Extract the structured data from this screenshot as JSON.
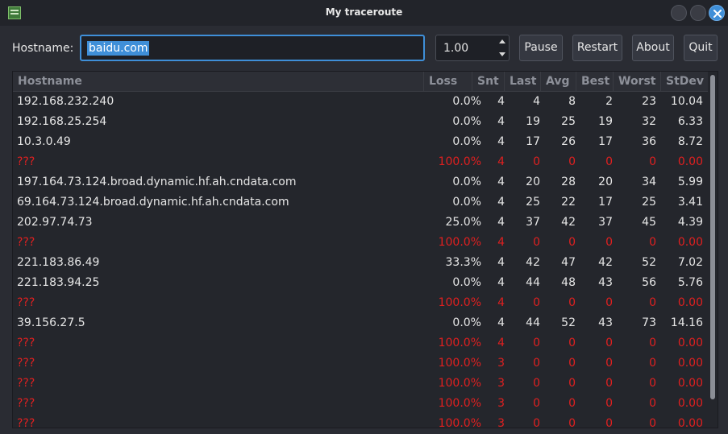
{
  "window": {
    "title": "My traceroute"
  },
  "toolbar": {
    "hostname_label": "Hostname:",
    "hostname_value": "baidu.com",
    "interval_value": "1.00",
    "pause_label": "Pause",
    "restart_label": "Restart",
    "about_label": "About",
    "quit_label": "Quit"
  },
  "table": {
    "columns": [
      "Hostname",
      "Loss",
      "Snt",
      "Last",
      "Avg",
      "Best",
      "Worst",
      "StDev"
    ],
    "rows": [
      {
        "host": "192.168.232.240",
        "loss": "0.0%",
        "snt": "4",
        "last": "4",
        "avg": "8",
        "best": "2",
        "worst": "23",
        "stdev": "10.04"
      },
      {
        "host": "192.168.25.254",
        "loss": "0.0%",
        "snt": "4",
        "last": "19",
        "avg": "25",
        "best": "19",
        "worst": "32",
        "stdev": "6.33"
      },
      {
        "host": "10.3.0.49",
        "loss": "0.0%",
        "snt": "4",
        "last": "17",
        "avg": "26",
        "best": "17",
        "worst": "36",
        "stdev": "8.72"
      },
      {
        "host": "???",
        "loss": "100.0%",
        "snt": "4",
        "last": "0",
        "avg": "0",
        "best": "0",
        "worst": "0",
        "stdev": "0.00"
      },
      {
        "host": "197.164.73.124.broad.dynamic.hf.ah.cndata.com",
        "loss": "0.0%",
        "snt": "4",
        "last": "20",
        "avg": "28",
        "best": "20",
        "worst": "34",
        "stdev": "5.99"
      },
      {
        "host": "69.164.73.124.broad.dynamic.hf.ah.cndata.com",
        "loss": "0.0%",
        "snt": "4",
        "last": "25",
        "avg": "22",
        "best": "17",
        "worst": "25",
        "stdev": "3.41"
      },
      {
        "host": "202.97.74.73",
        "loss": "25.0%",
        "snt": "4",
        "last": "37",
        "avg": "42",
        "best": "37",
        "worst": "45",
        "stdev": "4.39"
      },
      {
        "host": "???",
        "loss": "100.0%",
        "snt": "4",
        "last": "0",
        "avg": "0",
        "best": "0",
        "worst": "0",
        "stdev": "0.00"
      },
      {
        "host": "221.183.86.49",
        "loss": "33.3%",
        "snt": "4",
        "last": "42",
        "avg": "47",
        "best": "42",
        "worst": "52",
        "stdev": "7.02"
      },
      {
        "host": "221.183.94.25",
        "loss": "0.0%",
        "snt": "4",
        "last": "44",
        "avg": "48",
        "best": "43",
        "worst": "56",
        "stdev": "5.76"
      },
      {
        "host": "???",
        "loss": "100.0%",
        "snt": "4",
        "last": "0",
        "avg": "0",
        "best": "0",
        "worst": "0",
        "stdev": "0.00"
      },
      {
        "host": "39.156.27.5",
        "loss": "0.0%",
        "snt": "4",
        "last": "44",
        "avg": "52",
        "best": "43",
        "worst": "73",
        "stdev": "14.16"
      },
      {
        "host": "???",
        "loss": "100.0%",
        "snt": "4",
        "last": "0",
        "avg": "0",
        "best": "0",
        "worst": "0",
        "stdev": "0.00"
      },
      {
        "host": "???",
        "loss": "100.0%",
        "snt": "3",
        "last": "0",
        "avg": "0",
        "best": "0",
        "worst": "0",
        "stdev": "0.00"
      },
      {
        "host": "???",
        "loss": "100.0%",
        "snt": "3",
        "last": "0",
        "avg": "0",
        "best": "0",
        "worst": "0",
        "stdev": "0.00"
      },
      {
        "host": "???",
        "loss": "100.0%",
        "snt": "3",
        "last": "0",
        "avg": "0",
        "best": "0",
        "worst": "0",
        "stdev": "0.00"
      },
      {
        "host": "???",
        "loss": "100.0%",
        "snt": "3",
        "last": "0",
        "avg": "0",
        "best": "0",
        "worst": "0",
        "stdev": "0.00"
      }
    ]
  },
  "colors": {
    "accent": "#3f8fd8",
    "error_row": "#e02020",
    "background": "#2a2c33"
  },
  "icons": {
    "app": "network-monitor-icon",
    "close": "close-icon"
  }
}
